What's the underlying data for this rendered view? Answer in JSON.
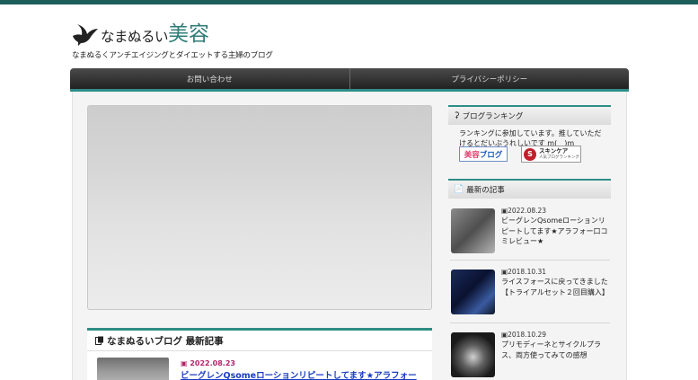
{
  "site": {
    "title_main": "なまぬるい",
    "title_accent": "美容",
    "tagline": "なまぬるくアンチエイジングとダイエットする主婦のブログ"
  },
  "nav": {
    "items": [
      {
        "label": "お問い合わせ"
      },
      {
        "label": "プライバシーポリシー"
      }
    ]
  },
  "main": {
    "latest_heading": "なまぬるいブログ 最新記事",
    "latest_post": {
      "date": "2022.08.23",
      "title": "ビーグレンQsomeローションリピートしてます★アラフォー"
    }
  },
  "sidebar": {
    "ranking": {
      "heading": "ブログランキング",
      "text": "ランキングに参加しています。推していただけるとだいぶうれしいです m(__)m",
      "banner1_a": "美容",
      "banner1_b": "ブログ",
      "banner2_mark": "S",
      "banner2_line1": "スキンケア",
      "banner2_line2": "人気ブログランキング"
    },
    "recent": {
      "heading": "最新の記事",
      "posts": [
        {
          "date": "2022.08.23",
          "title": "ビーグレンQsomeローションリピートしてます★アラフォー口コミレビュー★"
        },
        {
          "date": "2018.10.31",
          "title": "ライスフォースに戻ってきました【トライアルセット２回目購入】"
        },
        {
          "date": "2018.10.29",
          "title": "プリモディーネとサイクルプラス、両方使ってみての感想"
        }
      ]
    }
  },
  "colors": {
    "accent": "#2f8d86",
    "topbar": "#1e5e5a",
    "link": "#1a3cc0",
    "date_pink": "#b0266a"
  },
  "icons": {
    "logo": "bird-icon",
    "ranking": "trophy-icon",
    "recent": "document-icon",
    "date": "calendar-icon"
  }
}
